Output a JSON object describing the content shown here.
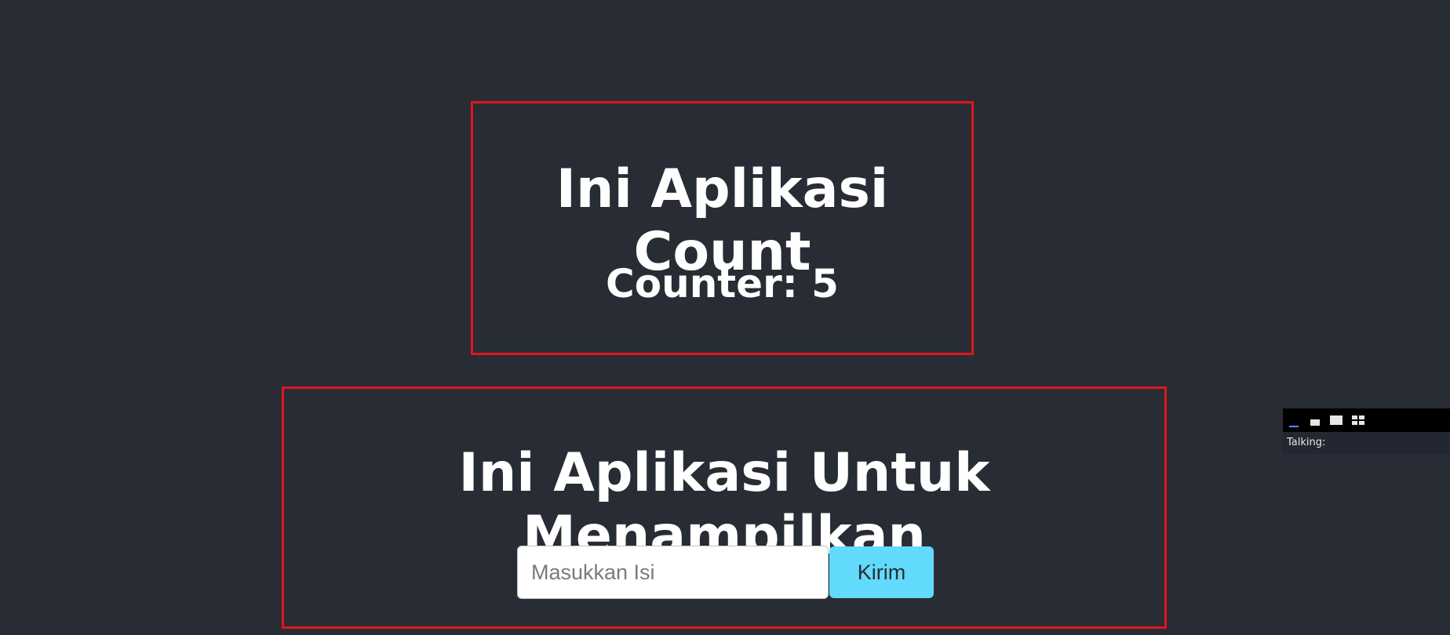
{
  "count_app": {
    "title": "Ini Aplikasi Count",
    "counter_label": "Counter: ",
    "counter_value": "5"
  },
  "display_app": {
    "title": "Ini Aplikasi Untuk Menampilkan",
    "input_placeholder": "Masukkan Isi",
    "input_value": "",
    "submit_label": "Kirim"
  },
  "widget": {
    "layout_icons": [
      "layout-minimized-icon",
      "layout-small-icon",
      "layout-large-icon",
      "layout-grid-icon"
    ],
    "talking_label": "Talking:"
  },
  "colors": {
    "background": "#282c34",
    "border": "#e0151b",
    "button": "#61dafb",
    "text": "#ffffff"
  }
}
